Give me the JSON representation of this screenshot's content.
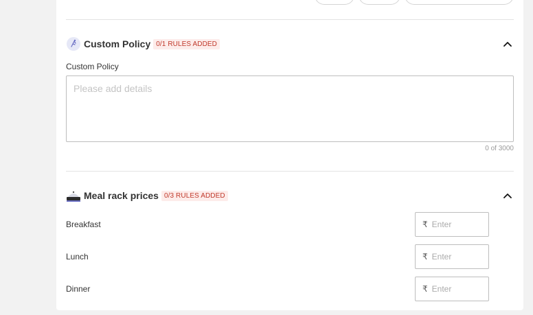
{
  "custom_policy": {
    "title": "Custom Policy",
    "badge": "0/1 RULES ADDED",
    "field_label": "Custom Policy",
    "placeholder": "Please add details",
    "value": "",
    "counter": "0 of 3000"
  },
  "meal_rack": {
    "title": "Meal rack prices",
    "badge": "0/3 RULES ADDED",
    "currency_symbol": "₹",
    "rows": [
      {
        "label": "Breakfast",
        "placeholder": "Enter",
        "value": ""
      },
      {
        "label": "Lunch",
        "placeholder": "Enter",
        "value": ""
      },
      {
        "label": "Dinner",
        "placeholder": "Enter",
        "value": ""
      }
    ]
  },
  "icons": {
    "custom_policy": "policy-icon",
    "meal_rack": "meal-tray-icon",
    "collapse": "chevron-up-icon"
  }
}
